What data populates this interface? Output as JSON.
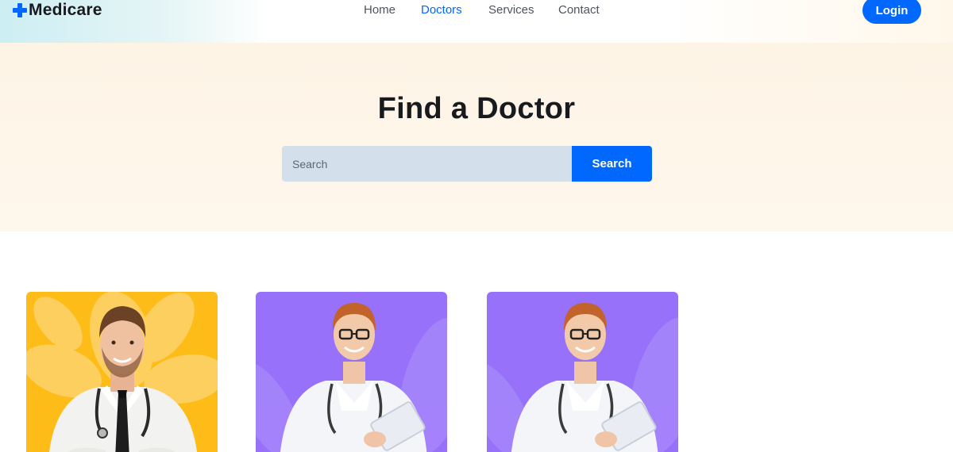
{
  "header": {
    "logo_text": "Medicare",
    "logo_icon": "plus-cross-icon",
    "nav": [
      {
        "label": "Home",
        "active": false
      },
      {
        "label": "Doctors",
        "active": true
      },
      {
        "label": "Services",
        "active": false
      },
      {
        "label": "Contact",
        "active": false
      }
    ],
    "login_label": "Login"
  },
  "hero": {
    "title": "Find a Doctor",
    "search_placeholder": "Search",
    "search_value": "",
    "search_button_label": "Search"
  },
  "doctors": [
    {
      "image": "doctor-photo",
      "background_color": "#febc18"
    },
    {
      "image": "doctor-photo",
      "background_color": "#9771fa"
    },
    {
      "image": "doctor-photo",
      "background_color": "#9771fa"
    }
  ],
  "colors": {
    "primary": "#0067ff",
    "heading": "#181a1e",
    "text": "#4e545f",
    "hero_bg": "#fef6e9",
    "search_bg": "#d3e0ec"
  }
}
